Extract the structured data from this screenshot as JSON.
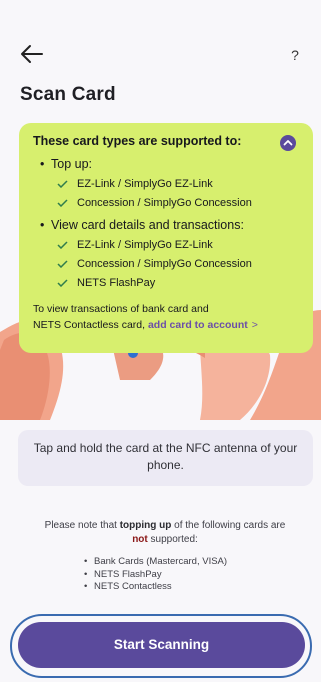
{
  "header": {
    "back_icon": "arrow-left-icon",
    "help_label": "?",
    "title": "Scan Card"
  },
  "panel": {
    "heading": "These card types are supported to:",
    "collapse_icon": "chevron-up-circle-icon",
    "sections": [
      {
        "label": "Top up:",
        "items": [
          "EZ-Link / SimplyGo EZ-Link",
          "Concession / SimplyGo Concession"
        ]
      },
      {
        "label": "View card details and transactions:",
        "items": [
          "EZ-Link / SimplyGo EZ-Link",
          "Concession / SimplyGo Concession",
          "NETS FlashPay"
        ]
      }
    ],
    "footnote_line1": "To view transactions of bank card and",
    "footnote_line2": "NETS Contactless card,",
    "add_card_link": "add card to account",
    "link_chevron": ">",
    "colors": {
      "panel_bg": "#d7ef6e",
      "accent": "#5a4a9c"
    }
  },
  "instruction": {
    "text": "Tap and hold the card at the NFC antenna of your phone."
  },
  "notice": {
    "part1": "Please note that",
    "bold": "topping up",
    "part2": "of the following cards are",
    "not": "not",
    "part3": "supported:",
    "unsupported": [
      "Bank Cards (Mastercard, VISA)",
      "NETS FlashPay",
      "NETS Contactless"
    ]
  },
  "cta": {
    "label": "Start Scanning",
    "color": "#5a4a9c"
  }
}
